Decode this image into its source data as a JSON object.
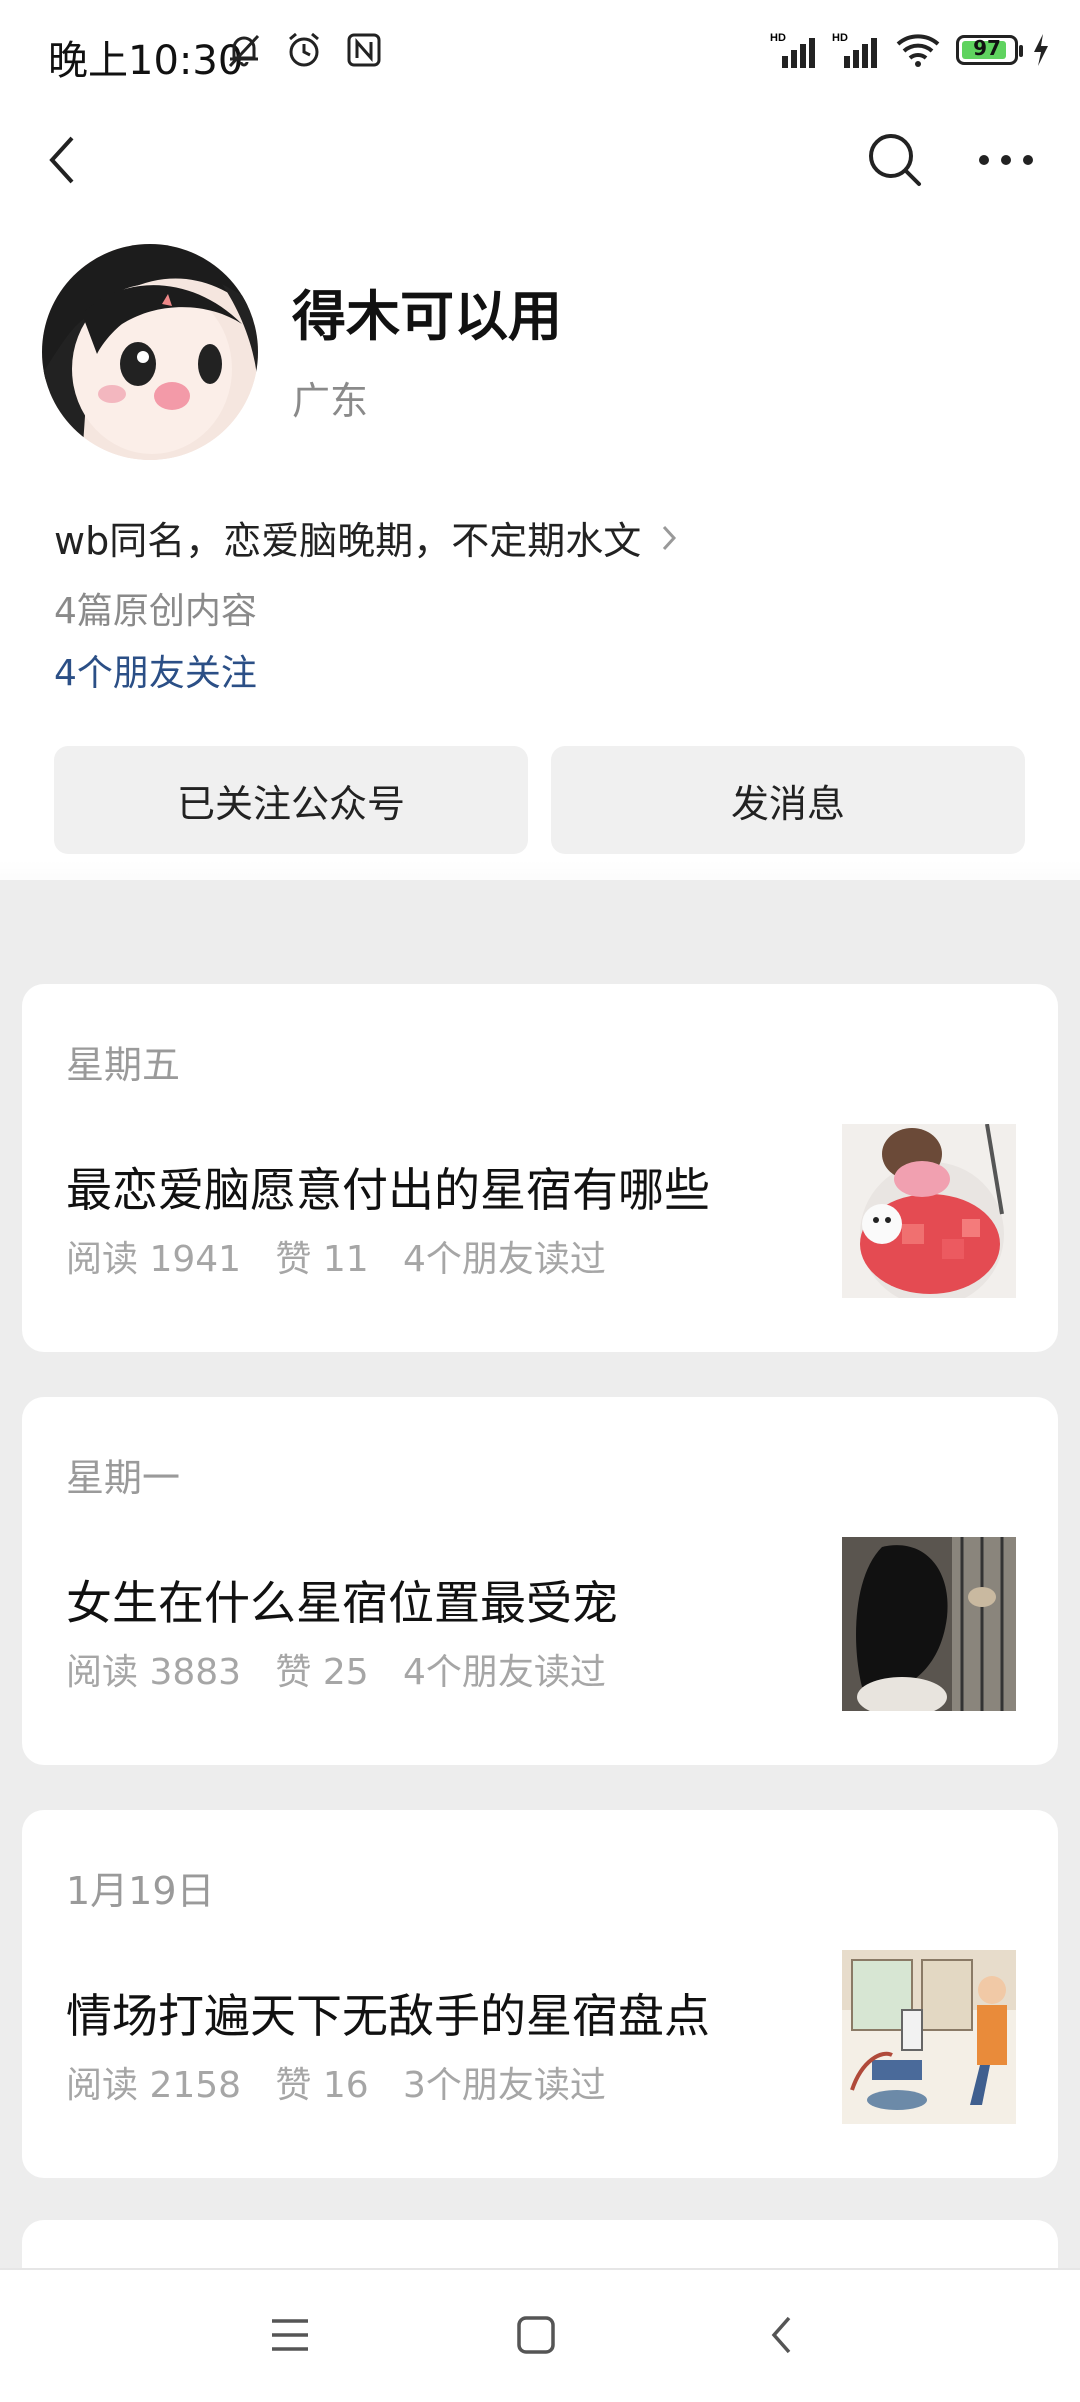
{
  "status_bar": {
    "time": "晚上10:30",
    "battery": "97",
    "signal_label_1": "HD",
    "signal_label_2": "HD"
  },
  "nav": {
    "back_icon": "chevron-left-icon",
    "search_icon": "search-icon",
    "more_icon": "more-icon"
  },
  "profile": {
    "name": "得木可以用",
    "region": "广东",
    "bio": "wb同名，恋爱脑晚期，不定期水文",
    "original_count": "4篇原创内容",
    "friends_following": "4个朋友关注"
  },
  "actions": {
    "followed_label": "已关注公众号",
    "message_label": "发消息"
  },
  "articles": [
    {
      "date": "星期五",
      "title": "最恋爱脑愿意付出的星宿有哪些",
      "meta": "阅读 1941   赞 11   4个朋友读过"
    },
    {
      "date": "星期一",
      "title": "女生在什么星宿位置最受宠",
      "meta": "阅读 3883   赞 25   4个朋友读过"
    },
    {
      "date": "1月19日",
      "title": "情场打遍天下无敌手的星宿盘点",
      "meta": "阅读 2158   赞 16   3个朋友读过"
    }
  ],
  "colors": {
    "link_blue": "#2b4f86",
    "muted_gray": "#8a8a8a",
    "background": "#ededed",
    "battery_green": "#5fd35f"
  }
}
